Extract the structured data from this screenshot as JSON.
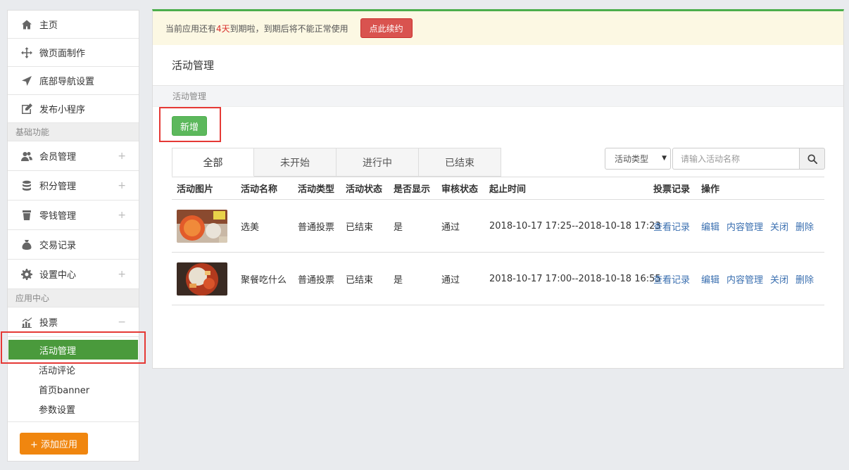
{
  "sidebar": {
    "top_items": [
      {
        "label": "主页",
        "icon": "home-icon"
      },
      {
        "label": "微页面制作",
        "icon": "move-icon"
      },
      {
        "label": "底部导航设置",
        "icon": "send-icon"
      },
      {
        "label": "发布小程序",
        "icon": "edit-icon"
      }
    ],
    "section_basic": "基础功能",
    "basic_items": [
      {
        "label": "会员管理",
        "icon": "users-icon",
        "expander": "+"
      },
      {
        "label": "积分管理",
        "icon": "database-icon",
        "expander": "+"
      },
      {
        "label": "零钱管理",
        "icon": "cup-icon",
        "expander": "+"
      },
      {
        "label": "交易记录",
        "icon": "money-bag-icon",
        "expander": ""
      },
      {
        "label": "设置中心",
        "icon": "gear-icon",
        "expander": "+"
      }
    ],
    "section_apps": "应用中心",
    "vote_item": {
      "label": "投票",
      "icon": "bar-chart-icon",
      "expander": "−"
    },
    "vote_sub": [
      "活动管理",
      "活动评论",
      "首页banner",
      "参数设置"
    ],
    "add_app_label": "+ 添加应用"
  },
  "notice": {
    "prefix": "当前应用还有",
    "days": "4天",
    "suffix": "到期啦，到期后将不能正常使用",
    "renew_label": "点此续约"
  },
  "page_title": "活动管理",
  "breadcrumb": "活动管理",
  "add_label": "新增",
  "tabs": [
    "全部",
    "未开始",
    "进行中",
    "已结束"
  ],
  "filter": {
    "select_label": "活动类型",
    "search_placeholder": "请输入活动名称"
  },
  "table": {
    "headers": [
      "活动图片",
      "活动名称",
      "活动类型",
      "活动状态",
      "是否显示",
      "审核状态",
      "起止时间",
      "投票记录",
      "操作"
    ],
    "rows": [
      {
        "name": "选美",
        "type": "普通投票",
        "status": "已结束",
        "show": "是",
        "audit": "通过",
        "time": "2018-10-17 17:25--2018-10-18 17:23",
        "record": "查看记录"
      },
      {
        "name": "聚餐吃什么",
        "type": "普通投票",
        "status": "已结束",
        "show": "是",
        "audit": "通过",
        "time": "2018-10-17 17:00--2018-10-18 16:55",
        "record": "查看记录"
      }
    ],
    "actions": [
      "编辑",
      "内容管理",
      "关闭",
      "删除"
    ]
  },
  "colors": {
    "accent_green": "#4a9a3c",
    "add_app_orange": "#f0860f",
    "renew_red": "#d9534f",
    "link_blue": "#3a6fb0"
  }
}
